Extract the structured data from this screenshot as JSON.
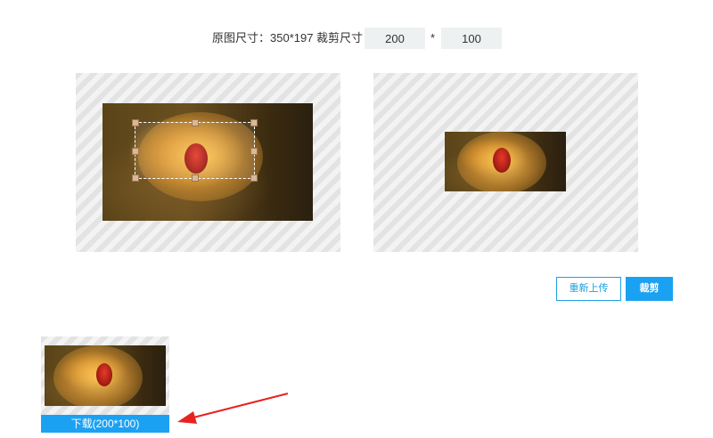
{
  "size_bar": {
    "original_size_label": "原图尺寸：350*197",
    "crop_size_label": "裁剪尺寸：",
    "width_value": "200",
    "separator": "*",
    "height_value": "100"
  },
  "actions": {
    "reupload_label": "重新上传",
    "crop_label": "裁剪"
  },
  "result": {
    "download_label": "下载(200*100)"
  },
  "colors": {
    "accent": "#1ba1f2",
    "annotation_arrow": "#e8231f"
  }
}
